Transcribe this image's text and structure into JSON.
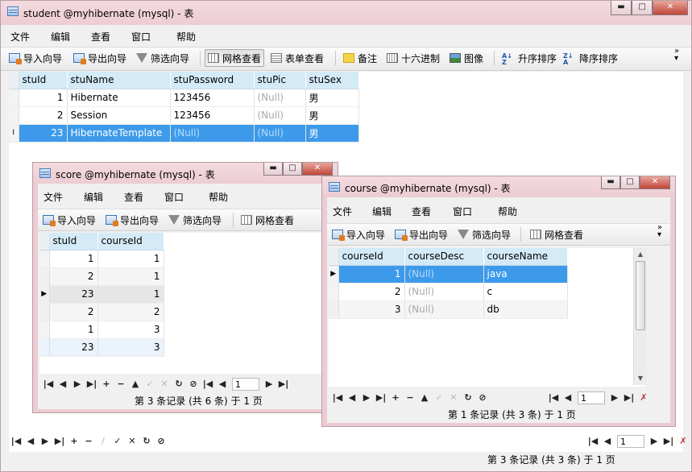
{
  "student": {
    "title": "student @myhibernate (mysql) - 表",
    "menu": [
      "文件",
      "编辑",
      "查看",
      "窗口",
      "帮助"
    ],
    "toolbar": {
      "import": "导入向导",
      "export": "导出向导",
      "filter": "筛选向导",
      "grid_view": "网格查看",
      "form_view": "表单查看",
      "memo": "备注",
      "hex": "十六进制",
      "image": "图像",
      "sort_asc": "升序排序",
      "sort_desc": "降序排序",
      "more": "»"
    },
    "columns": [
      "stuId",
      "stuName",
      "stuPassword",
      "stuPic",
      "stuSex"
    ],
    "rows": [
      [
        "1",
        "Hibernate",
        "123456",
        "(Null)",
        "男"
      ],
      [
        "2",
        "Session",
        "123456",
        "(Null)",
        "男"
      ],
      [
        "23",
        "HibernateTemplate",
        "(Null)",
        "(Null)",
        "男"
      ]
    ],
    "row_indicator": "I",
    "page": "1",
    "status": "第 3 条记录 (共 3 条) 于 1 页"
  },
  "score": {
    "title": "score @myhibernate (mysql) - 表",
    "menu": [
      "文件",
      "编辑",
      "查看",
      "窗口",
      "帮助"
    ],
    "toolbar": {
      "import": "导入向导",
      "export": "导出向导",
      "filter": "筛选向导",
      "grid_view": "网格查看"
    },
    "columns": [
      "stuId",
      "courseId"
    ],
    "rows": [
      [
        "1",
        "1"
      ],
      [
        "2",
        "1"
      ],
      [
        "23",
        "1"
      ],
      [
        "2",
        "2"
      ],
      [
        "1",
        "3"
      ],
      [
        "23",
        "3"
      ]
    ],
    "row_indicator": "▶",
    "page": "1",
    "status": "第 3 条记录 (共 6 条) 于 1 页"
  },
  "course": {
    "title": "course @myhibernate (mysql) - 表",
    "menu": [
      "文件",
      "编辑",
      "查看",
      "窗口",
      "帮助"
    ],
    "toolbar": {
      "import": "导入向导",
      "export": "导出向导",
      "filter": "筛选向导",
      "grid_view": "网格查看",
      "more": "»"
    },
    "columns": [
      "courseId",
      "courseDesc",
      "courseName"
    ],
    "rows": [
      [
        "1",
        "(Null)",
        "java"
      ],
      [
        "2",
        "(Null)",
        "c"
      ],
      [
        "3",
        "(Null)",
        "db"
      ]
    ],
    "row_indicator": "▶",
    "page": "1",
    "status": "第 1 条记录 (共 3 条) 于 1 页"
  },
  "colors": {
    "selection": "#3d9aeb",
    "header": "#d4eaf7",
    "titlebar": "#ecccd2"
  }
}
